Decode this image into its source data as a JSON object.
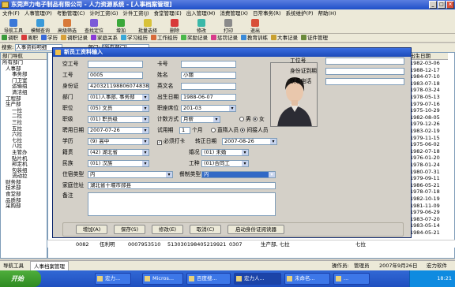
{
  "app": {
    "title": "东莞声力电子制品有限公司 - 人力资源系统 - [人事档案管理]",
    "window_controls": [
      "_",
      "□",
      "×"
    ]
  },
  "menu": [
    "文件(F)",
    "人事管理(P)",
    "考勤管理(C)",
    "计时工资(G)",
    "计件工资(J)",
    "食堂管理(E)",
    "出入管理(M)",
    "消费管理(X)",
    "日常事务(R)",
    "系统维护(P)",
    "帮助(H)"
  ],
  "toolbar": [
    "导航工具",
    "模糊查询",
    "高级筛选",
    "查找定位",
    "增加",
    "批量选择",
    "删除",
    "修改",
    "打印",
    "退出"
  ],
  "toolbar_icon_colors": [
    "#3a78d8",
    "#3a9ad8",
    "#d87a3a",
    "#7a5ad8",
    "#3aa83a",
    "#d8c23a",
    "#d83a3a",
    "#3ab8a8",
    "#8a8a8a",
    "#d8503a"
  ],
  "toolbar2": [
    "调职",
    "离职",
    "学历",
    "调职记录",
    "家庭关系",
    "学习经历",
    "工作经历",
    "奖励记录",
    "惩罚记录",
    "教育训练",
    "大事记录",
    "证件管理"
  ],
  "toolbar2_icon_colors": [
    "#3a9a3a",
    "#d83a3a",
    "#3a6ad8",
    "#d8a03a",
    "#8a3ad8",
    "#3aa8d8",
    "#d86a3a",
    "#4ab84a",
    "#d83a8a",
    "#3a8ad8",
    "#c8a030",
    "#6a8a3a"
  ],
  "search_bar": {
    "label": "搜索:",
    "value": "人事资料明细",
    "filter_label": "部门:",
    "filter_value": "[所有部门]"
  },
  "tree": {
    "header": "部门导航",
    "nodes": [
      "所有部门",
      "人事部",
      "事务部",
      "门卫室",
      "运输组",
      "清洁组",
      "工程部",
      "生产部",
      "一拉",
      "二拉",
      "三拉",
      "五拉",
      "六拉",
      "七拉",
      "八拉",
      "主管办",
      "贴片机",
      "邦定机",
      "包装组",
      "流动拉",
      "财务部",
      "技术部",
      "食堂部",
      "品质部",
      "采购部"
    ]
  },
  "grid": {
    "date_column_header": "出生日期",
    "dates": [
      "1982-03-06",
      "1988-12-17",
      "1984-07-10",
      "1983-07-18",
      "1978-03-24",
      "1978-05-13",
      "1979-07-16",
      "1975-10-29",
      "1982-08-05",
      "1979-12-26",
      "1983-02-19",
      "1979-11-15",
      "1975-06-02",
      "1982-07-18",
      "1976-01-20",
      "1978-01-24",
      "1980-07-31",
      "1979-09-11",
      "1986-05-21",
      "1978-07-18",
      "1982-10-19",
      "1981-11-09",
      "1979-06-29",
      "1983-07-20",
      "1983-05-14",
      "1984-05-21"
    ],
    "bottom_row": [
      "0082",
      "伍利明",
      "0007953510",
      "513030198405219921",
      "0307",
      "生产部, 七拉",
      "七拉"
    ]
  },
  "dialog": {
    "title": "新员工资料输入",
    "labels": {
      "empno": "空工号",
      "card": "卡号",
      "workno": "工号",
      "name": "姓名",
      "idcard": "身份证",
      "engname": "英文名",
      "dept": "部门",
      "birth": "出生日期",
      "position": "职位",
      "seat": "职座席位",
      "rank": "职级",
      "pay": "计数方式",
      "hire": "聘用日期",
      "trial": "试用期",
      "month_unit": "个月",
      "trial_status": "直隋入员",
      "edu": "学历",
      "must_punch": "必须打卡",
      "regular_date": "转正日期",
      "native": "籍贯",
      "marriage": "婚况",
      "nation": "民族",
      "worktype": "工种",
      "lodging": "住宿类型",
      "lodging2": "餐制类型",
      "address": "家庭住址",
      "remark": "备注",
      "nation_label": "国籍",
      "inout": "间接人员",
      "male": "男",
      "female": "女"
    },
    "values": {
      "empno": "",
      "card": "",
      "workno": "0005",
      "name": "小丽",
      "idcard": "420321198806074838",
      "engname": "",
      "dept": "(01)人事部, 事务部",
      "birth": "1988-06-07",
      "position": "(05) 文员",
      "seat": "201-03",
      "rank": "(01) 职员级",
      "pay": "月薪",
      "hire": "2007-07-26",
      "trial": "1",
      "edu": "(9) 高中",
      "regular_date": "2007-08-26",
      "native": "(42) 湖北省",
      "marriage": "(01) 未婚",
      "nation": "(01) 汉族",
      "worktype": "(01)合同工",
      "lodging": "内",
      "lodging2": "内",
      "address": "湖北省十堰市郧县",
      "remark": "",
      "gender": "女"
    },
    "right_labels": [
      "工位号",
      "身份证到期",
      "联系电话"
    ],
    "buttons": [
      "增加(A)",
      "保存(S)",
      "修改(E)",
      "取消(C)",
      "启动身份证阅读器"
    ]
  },
  "statusbar": {
    "left": "导航工具",
    "tab": "人事档案管理",
    "operator_label": "操作员:",
    "operator": "管理员",
    "date": "2007年9月26日",
    "company": "宏力软件"
  },
  "taskbar": {
    "start": "开始",
    "tasks": [
      "宏力...",
      "Micros...",
      "百度搜...",
      "宏力人...",
      "未命名...",
      "..."
    ],
    "clock": "18:21"
  }
}
